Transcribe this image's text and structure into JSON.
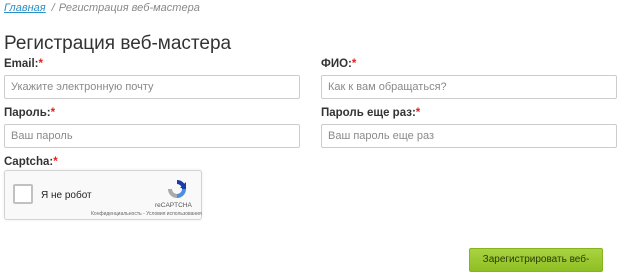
{
  "breadcrumb": {
    "home": "Главная",
    "separator": "/",
    "current": "Регистрация веб-мастера"
  },
  "page_title": "Регистрация веб-мастера",
  "required_mark": "*",
  "form": {
    "email": {
      "label": "Email:",
      "placeholder": "Укажите электронную почту",
      "value": ""
    },
    "fio": {
      "label": "ФИО:",
      "placeholder": "Как к вам обращаться?",
      "value": ""
    },
    "password": {
      "label": "Пароль:",
      "placeholder": "Ваш пароль",
      "value": ""
    },
    "password_repeat": {
      "label": "Пароль еще раз:",
      "placeholder": "Ваш пароль еще раз",
      "value": ""
    },
    "captcha": {
      "label": "Captcha:"
    }
  },
  "recaptcha": {
    "checkbox_label": "Я не робот",
    "brand": "reCAPTCHA",
    "terms": "Конфиденциальность - Условия использования",
    "checked": false,
    "icon": "recaptcha-logo-icon"
  },
  "submit_label": "Зарегистрировать веб-мастера",
  "colors": {
    "link": "#2a8fc7",
    "required": "#e02222",
    "submit_bg": "#9bc92f"
  }
}
